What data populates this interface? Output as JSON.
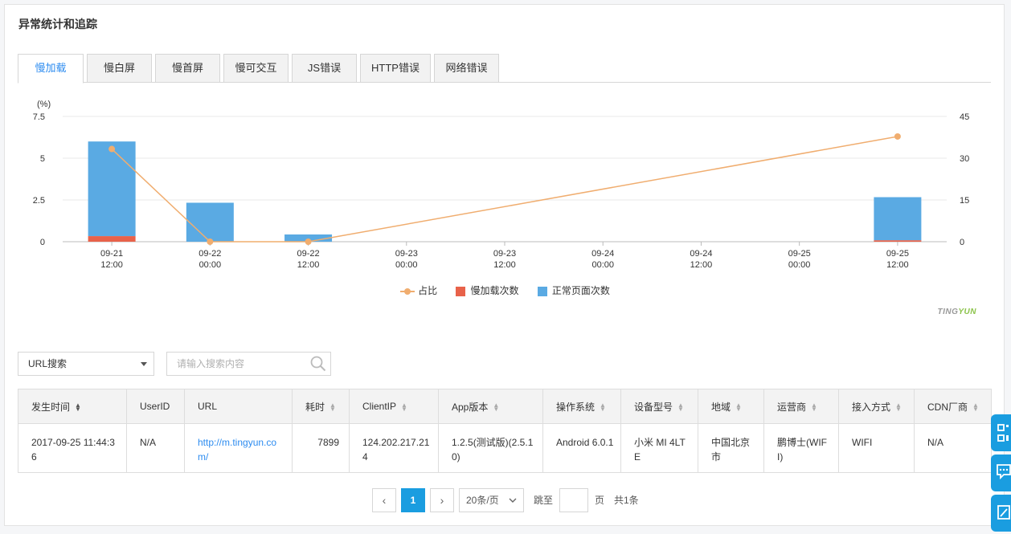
{
  "panel": {
    "title": "异常统计和追踪"
  },
  "tabs": [
    {
      "label": "慢加载",
      "active": true
    },
    {
      "label": "慢白屏"
    },
    {
      "label": "慢首屏"
    },
    {
      "label": "慢可交互"
    },
    {
      "label": "JS错误"
    },
    {
      "label": "HTTP错误"
    },
    {
      "label": "网络错误"
    }
  ],
  "chart_data": {
    "type": "bar",
    "y_left_unit": "(%)",
    "y_left_ticks": [
      "7.5",
      "5",
      "2.5",
      "0"
    ],
    "y_left_range": [
      0,
      7.5
    ],
    "y_right_ticks": [
      "45",
      "30",
      "15",
      "0"
    ],
    "y_right_range": [
      0,
      45
    ],
    "x_ticks": [
      [
        "09-21",
        "12:00"
      ],
      [
        "09-22",
        "00:00"
      ],
      [
        "09-22",
        "12:00"
      ],
      [
        "09-23",
        "00:00"
      ],
      [
        "09-23",
        "12:00"
      ],
      [
        "09-24",
        "00:00"
      ],
      [
        "09-24",
        "12:00"
      ],
      [
        "09-25",
        "00:00"
      ],
      [
        "09-25",
        "12:00"
      ]
    ],
    "series": [
      {
        "name": "占比",
        "kind": "line",
        "axis": "left",
        "color": "#f0ad6f",
        "points": [
          {
            "x": 0,
            "y": 5.55
          },
          {
            "x": 1,
            "y": 0
          },
          {
            "x": 2,
            "y": 0
          },
          {
            "x": 8,
            "y": 6.3
          }
        ]
      },
      {
        "name": "慢加载次数",
        "kind": "bar",
        "axis": "right",
        "color": "#e8624a",
        "points": [
          {
            "x": 0,
            "y": 2
          },
          {
            "x": 1,
            "y": 0
          },
          {
            "x": 2,
            "y": 0
          },
          {
            "x": 8,
            "y": 0.5
          }
        ]
      },
      {
        "name": "正常页面次数",
        "kind": "bar",
        "axis": "right",
        "color": "#5aaae3",
        "points": [
          {
            "x": 0,
            "y": 34
          },
          {
            "x": 1,
            "y": 14
          },
          {
            "x": 2,
            "y": 2.6
          },
          {
            "x": 8,
            "y": 15.5
          }
        ]
      }
    ]
  },
  "watermark": {
    "prefix": "TING",
    "suffix": "YUN"
  },
  "filter": {
    "select_value": "URL搜索",
    "search_placeholder": "请输入搜索内容"
  },
  "table": {
    "columns": [
      "发生时间",
      "UserID",
      "URL",
      "耗时",
      "ClientIP",
      "App版本",
      "操作系统",
      "设备型号",
      "地域",
      "运营商",
      "接入方式",
      "CDN厂商"
    ],
    "rows": [
      {
        "time": "2017-09-25 11:44:36",
        "userid": "N/A",
        "url": "http://m.tingyun.com/",
        "duration": "7899",
        "clientip": "124.202.217.214",
        "app_version": "1.2.5(测试版)(2.5.10)",
        "os": "Android 6.0.1",
        "device": "小米 MI 4LTE",
        "region": "中国北京市",
        "carrier": "鹏博士(WIFI)",
        "access": "WIFI",
        "cdn": "N/A"
      }
    ]
  },
  "pager": {
    "prev": "‹",
    "current": "1",
    "next": "›",
    "page_size": "20条/页",
    "jump_label": "跳至",
    "page_unit": "页",
    "total": "共1条"
  },
  "colors": {
    "accent": "#1a9de0",
    "link": "#2d8cf0"
  },
  "icons": {
    "side_buttons": [
      "qrcode-icon",
      "chat-icon",
      "edit-icon"
    ]
  }
}
